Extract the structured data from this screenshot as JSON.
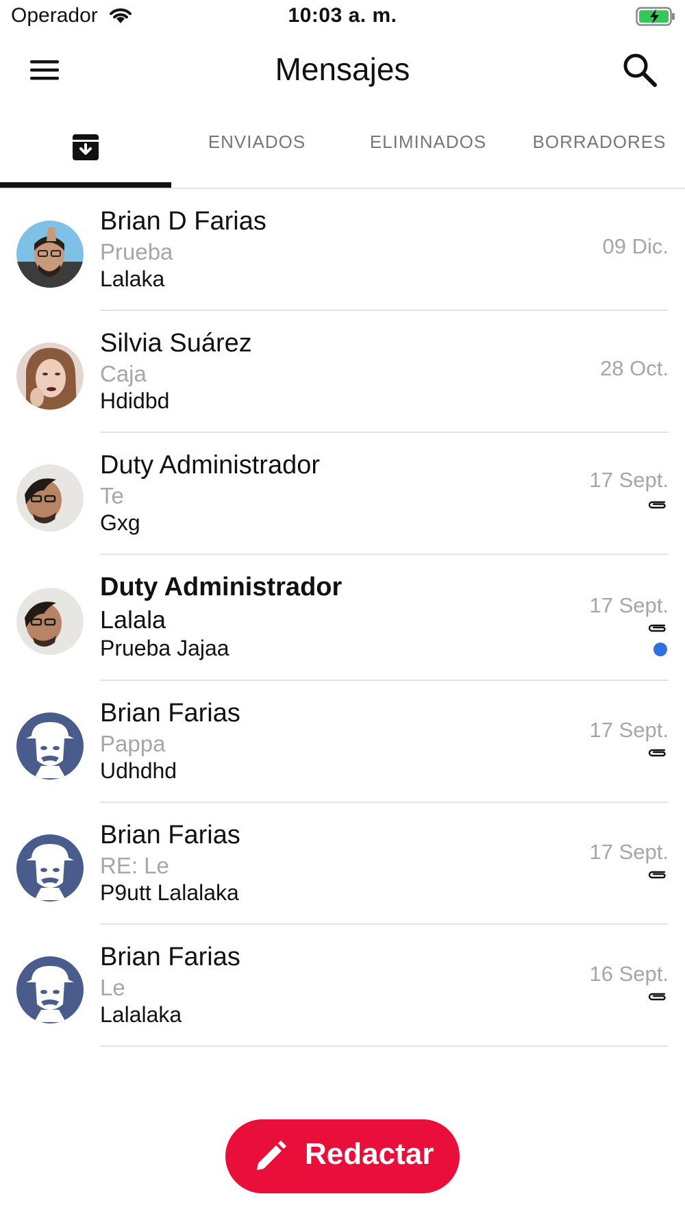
{
  "status_bar": {
    "carrier": "Operador",
    "time": "10:03 a. m."
  },
  "header": {
    "title": "Mensajes",
    "menu_icon": "hamburger-menu-icon",
    "search_icon": "search-icon"
  },
  "tabs": [
    {
      "id": "inbox",
      "label": "",
      "icon": "inbox-icon",
      "active": true
    },
    {
      "id": "sent",
      "label": "ENVIADOS",
      "active": false
    },
    {
      "id": "deleted",
      "label": "ELIMINADOS",
      "active": false
    },
    {
      "id": "drafts",
      "label": "BORRADORES",
      "active": false
    }
  ],
  "messages": [
    {
      "sender": "Brian D Farias",
      "subject": "Prueba",
      "preview": "Lalaka",
      "date": "09 Dic.",
      "attachment": false,
      "unread": false,
      "avatar": "photo-man-glasses"
    },
    {
      "sender": "Silvia Suárez",
      "subject": "Caja",
      "preview": "Hdidbd",
      "date": "28 Oct.",
      "attachment": false,
      "unread": false,
      "avatar": "photo-woman"
    },
    {
      "sender": "Duty Administrador",
      "subject": "Te",
      "preview": "Gxg",
      "date": "17 Sept.",
      "attachment": true,
      "unread": false,
      "avatar": "photo-man-selfie"
    },
    {
      "sender": "Duty Administrador",
      "subject": "Lalala",
      "preview": "Prueba Jajaa",
      "date": "17 Sept.",
      "attachment": true,
      "unread": true,
      "avatar": "photo-man-selfie"
    },
    {
      "sender": "Brian Farias",
      "subject": "Pappa",
      "preview": "Udhdhd",
      "date": "17 Sept.",
      "attachment": true,
      "unread": false,
      "avatar": "cartoon-man-hat"
    },
    {
      "sender": "Brian Farias",
      "subject": "RE: Le",
      "preview": "P9utt Lalalaka",
      "date": "17 Sept.",
      "attachment": true,
      "unread": false,
      "avatar": "cartoon-man-hat"
    },
    {
      "sender": "Brian Farias",
      "subject": "Le",
      "preview": "Lalalaka",
      "date": "16 Sept.",
      "attachment": true,
      "unread": false,
      "avatar": "cartoon-man-hat"
    }
  ],
  "compose": {
    "label": "Redactar",
    "icon": "pencil-icon"
  },
  "colors": {
    "accent": "#ea0e3a",
    "unread_dot": "#2f6fe0",
    "muted_text": "#a6a6a6",
    "avatar_cartoon_bg": "#4a5c8c",
    "battery_green": "#35c759"
  }
}
